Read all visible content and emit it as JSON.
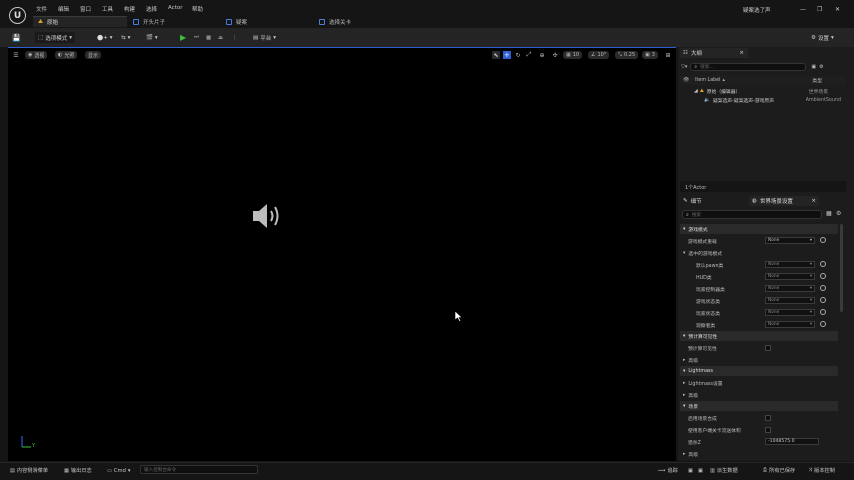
{
  "window": {
    "title": "疑案选了声",
    "tabs": [
      {
        "label": "原始",
        "active": true
      },
      {
        "label": "开头片子"
      },
      {
        "label": "疑案"
      },
      {
        "label": "选择关卡"
      }
    ],
    "controls": {
      "minimize": "—",
      "maximize": "❐",
      "close": "✕"
    }
  },
  "menu": [
    "文件",
    "编辑",
    "窗口",
    "工具",
    "构建",
    "选择",
    "Actor",
    "帮助"
  ],
  "toolbar": {
    "mode_label": "选项模式",
    "platform_label": "平台",
    "settings_label": "设置"
  },
  "viewport": {
    "perspective": "透视",
    "lit": "光照",
    "show": "显示",
    "grid_size": "10",
    "rotation": "10°",
    "scale": "0.25",
    "camera_speed": "3",
    "axis_y": "Y"
  },
  "outliner": {
    "title": "大纲",
    "search_placeholder": "搜索...",
    "col_label": "Item Label",
    "col_type": "类型",
    "items": [
      {
        "label": "原始（编辑器）",
        "type": "世界场景"
      },
      {
        "label": "疑案选声-疑案选声-游戏原声",
        "type": "AmbientSound"
      }
    ],
    "actor_count": "1个Actor"
  },
  "details": {
    "tab_details": "细节",
    "tab_world": "世界场景设置",
    "search_placeholder": "搜索",
    "none": "None",
    "rows": [
      {
        "label": "游戏模式",
        "kind": "section"
      },
      {
        "label": "游戏模式重载",
        "kind": "dropdown"
      },
      {
        "label": "选中的游戏模式",
        "kind": "subsection"
      },
      {
        "label": "默认pawn类",
        "kind": "dropdown-dim"
      },
      {
        "label": "HUD类",
        "kind": "dropdown-dim"
      },
      {
        "label": "玩家控制器类",
        "kind": "dropdown-dim"
      },
      {
        "label": "游戏状态类",
        "kind": "dropdown-dim"
      },
      {
        "label": "玩家状态类",
        "kind": "dropdown-dim"
      },
      {
        "label": "观察者类",
        "kind": "dropdown-dim"
      },
      {
        "label": "预计算可见性",
        "kind": "section"
      },
      {
        "label": "预计算可见性",
        "kind": "check"
      },
      {
        "label": "高级",
        "kind": "collapsed"
      },
      {
        "label": "Lightmass",
        "kind": "section"
      },
      {
        "label": "Lightmass设置",
        "kind": "collapsed"
      },
      {
        "label": "高级",
        "kind": "collapsed"
      },
      {
        "label": "场景",
        "kind": "section"
      },
      {
        "label": "启用场景合成",
        "kind": "check"
      },
      {
        "label": "使用客户端关卡流送体积",
        "kind": "check"
      },
      {
        "label": "猎杀Z",
        "kind": "value",
        "value": "-1048575.0"
      },
      {
        "label": "高级",
        "kind": "collapsed"
      }
    ]
  },
  "statusbar": {
    "content_drawer": "内容侧滑菜单",
    "output_log": "输出日志",
    "cmd": "Cmd",
    "console_placeholder": "输入控制台命令",
    "trace": "追踪",
    "derived_data": "派生数据",
    "all_saved": "所有已保存",
    "source_control": "版本控制"
  }
}
